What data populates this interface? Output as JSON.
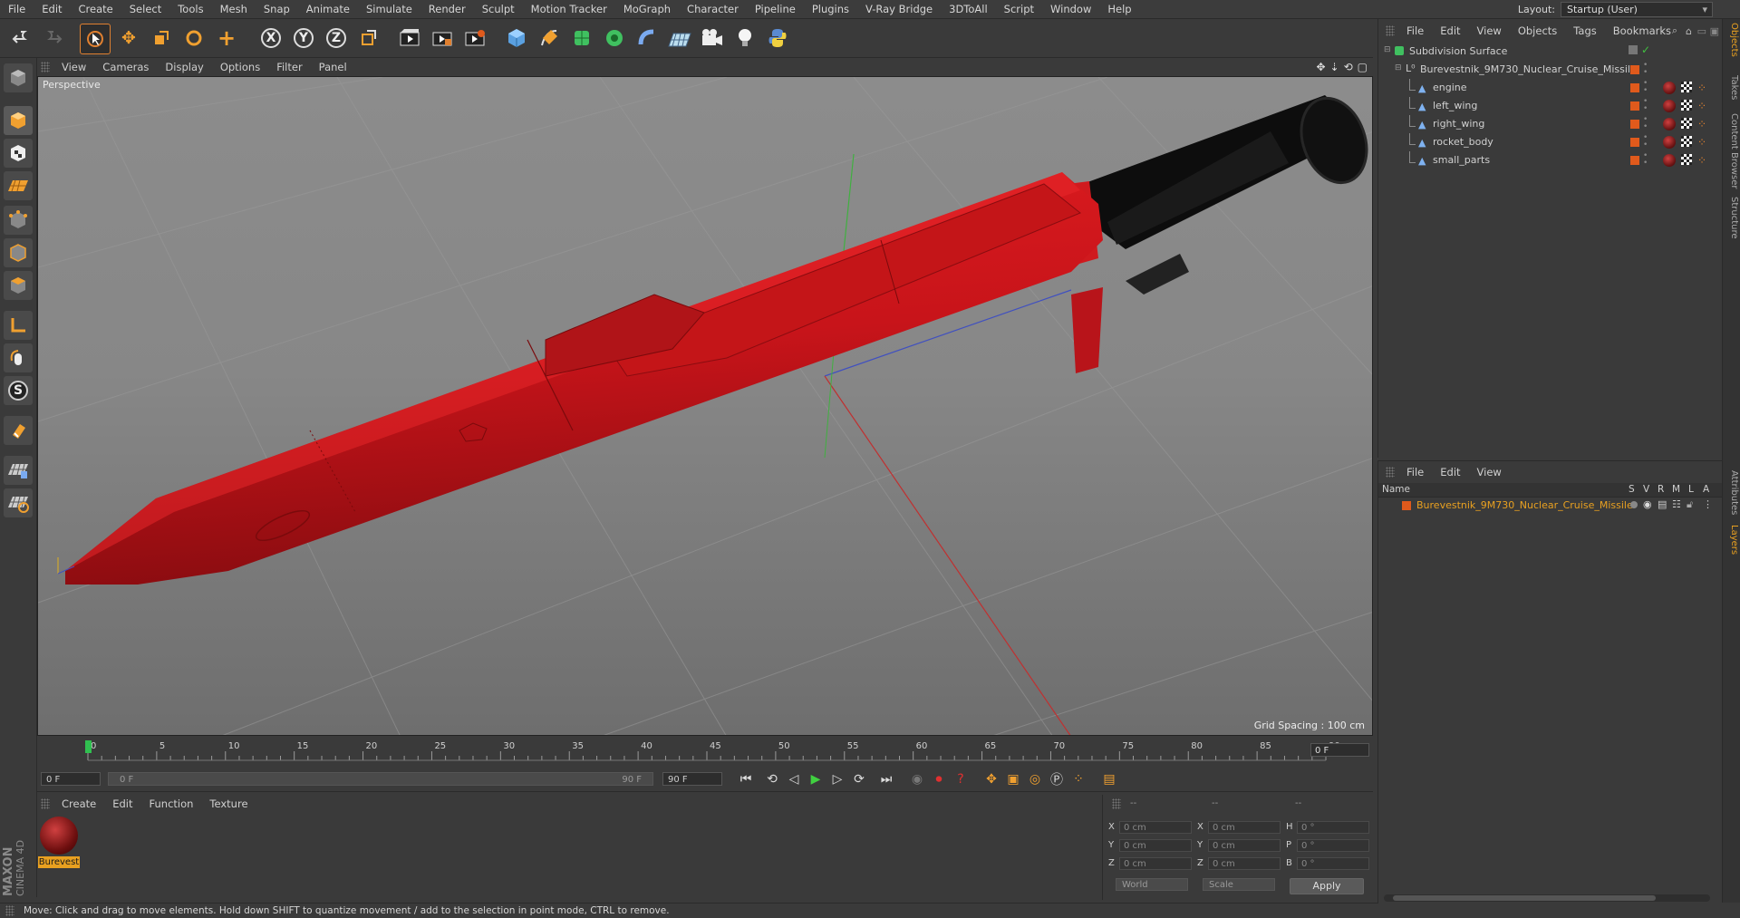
{
  "menubar": {
    "items": [
      "File",
      "Edit",
      "Create",
      "Select",
      "Tools",
      "Mesh",
      "Snap",
      "Animate",
      "Simulate",
      "Render",
      "Sculpt",
      "Motion Tracker",
      "MoGraph",
      "Character",
      "Pipeline",
      "Plugins",
      "V-Ray Bridge",
      "3DToAll",
      "Script",
      "Window",
      "Help"
    ],
    "layout_label": "Layout:",
    "layout_value": "Startup (User)"
  },
  "toolbar": {
    "icons": [
      "undo-icon",
      "redo-icon",
      "select-arrow-icon",
      "move-icon",
      "scale-icon",
      "rotate-icon",
      "add-object-icon",
      "x-axis-lock-icon",
      "y-axis-lock-icon",
      "z-axis-lock-icon",
      "coordinate-system-icon",
      "render-view-icon",
      "render-picture-viewer-icon",
      "edit-render-settings-icon",
      "cube-primitive-icon",
      "pen-spline-icon",
      "subdivision-icon",
      "cloner-icon",
      "deformer-icon",
      "floor-icon",
      "camera-icon",
      "light-icon",
      "python-icon"
    ],
    "axis_labels": [
      "X",
      "Y",
      "Z"
    ]
  },
  "left_toolbar": {
    "icons": [
      "make-editable-icon",
      "model-mode-icon",
      "texture-mode-icon",
      "points-mode-icon",
      "edges-mode-icon",
      "polygons-mode-icon",
      "axis-mode-icon",
      "live-selection-icon",
      "snap-icon",
      "magnet-icon",
      "workplane-icon",
      "locked-workplane-icon"
    ],
    "snap_label": "S",
    "brand_top": "MAXON",
    "brand_bottom": "CINEMA 4D"
  },
  "viewport": {
    "menu": [
      "View",
      "Cameras",
      "Display",
      "Options",
      "Filter",
      "Panel"
    ],
    "camera_label": "Perspective",
    "grid_spacing": "Grid Spacing : 100 cm"
  },
  "timeline": {
    "ticks": [
      "0",
      "5",
      "10",
      "15",
      "20",
      "25",
      "30",
      "35",
      "40",
      "45",
      "50",
      "55",
      "60",
      "65",
      "70",
      "75",
      "80",
      "85",
      "90"
    ],
    "current_frame_box": "0 F",
    "start_field": "0 F",
    "range_start": "0 F",
    "range_end": "90 F",
    "end_field": "90 F",
    "current_frame": 0,
    "total_frames": 90
  },
  "materials": {
    "menu": [
      "Create",
      "Edit",
      "Function",
      "Texture"
    ],
    "items": [
      {
        "name": "Burevest"
      }
    ]
  },
  "coordinates": {
    "header": [
      "--",
      "--",
      "--"
    ],
    "rows": [
      {
        "l1": "X",
        "v1": "0 cm",
        "l2": "X",
        "v2": "0 cm",
        "l3": "H",
        "v3": "0 °"
      },
      {
        "l1": "Y",
        "v1": "0 cm",
        "l2": "Y",
        "v2": "0 cm",
        "l3": "P",
        "v3": "0 °"
      },
      {
        "l1": "Z",
        "v1": "0 cm",
        "l2": "Z",
        "v2": "0 cm",
        "l3": "B",
        "v3": "0 °"
      }
    ],
    "world_select": "World",
    "scale_select": "Scale",
    "apply": "Apply"
  },
  "object_manager": {
    "menu": [
      "File",
      "Edit",
      "View",
      "Objects",
      "Tags",
      "Bookmarks"
    ],
    "objects": [
      {
        "name": "Subdivision Surface",
        "depth": 0
      },
      {
        "name": "Burevestnik_9M730_Nuclear_Cruise_Missile",
        "depth": 1
      },
      {
        "name": "engine",
        "depth": 2
      },
      {
        "name": "left_wing",
        "depth": 2
      },
      {
        "name": "right_wing",
        "depth": 2
      },
      {
        "name": "rocket_body",
        "depth": 2
      },
      {
        "name": "small_parts",
        "depth": 2
      }
    ]
  },
  "layers": {
    "menu": [
      "File",
      "Edit",
      "View"
    ],
    "columns": [
      "Name",
      "S",
      "V",
      "R",
      "M",
      "L",
      "A"
    ],
    "items": [
      {
        "name": "Burevestnik_9M730_Nuclear_Cruise_Missile"
      }
    ]
  },
  "right_tabs": [
    "Objects",
    "Takes",
    "Content Browser",
    "Structure",
    "Attributes",
    "Layers"
  ],
  "status": "Move: Click and drag to move elements. Hold down SHIFT to quantize movement / add to the selection in point mode, CTRL to remove.",
  "colors": {
    "accent": "#e8a020",
    "missile": "#c8141a",
    "selection": "#e05a1c"
  }
}
